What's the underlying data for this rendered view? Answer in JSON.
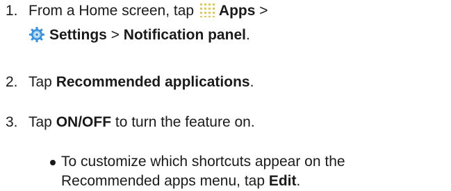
{
  "steps": [
    {
      "number": "1.",
      "line1_prefix": "From a Home screen, tap ",
      "apps_label": "Apps",
      "line1_suffix": " >",
      "settings_label": "Settings",
      "sep": " > ",
      "notification_label": "Notification panel",
      "end": "."
    },
    {
      "number": "2.",
      "prefix": "Tap ",
      "bold": "Recommended applications",
      "end": "."
    },
    {
      "number": "3.",
      "prefix": "Tap ",
      "bold": "ON/OFF",
      "suffix": " to turn the feature on."
    }
  ],
  "bullet": {
    "line1": "To customize which shortcuts appear on the",
    "line2_prefix": "Recommended apps menu, tap ",
    "bold": "Edit",
    "end": "."
  },
  "icons": {
    "apps": "apps-grid-icon",
    "settings": "settings-gear-icon"
  },
  "colors": {
    "text": "#1a1a1a",
    "apps_icon": "#d9c85a",
    "settings_icon_outer": "#3a8fd8",
    "settings_icon_inner": "#9fd0f5"
  }
}
